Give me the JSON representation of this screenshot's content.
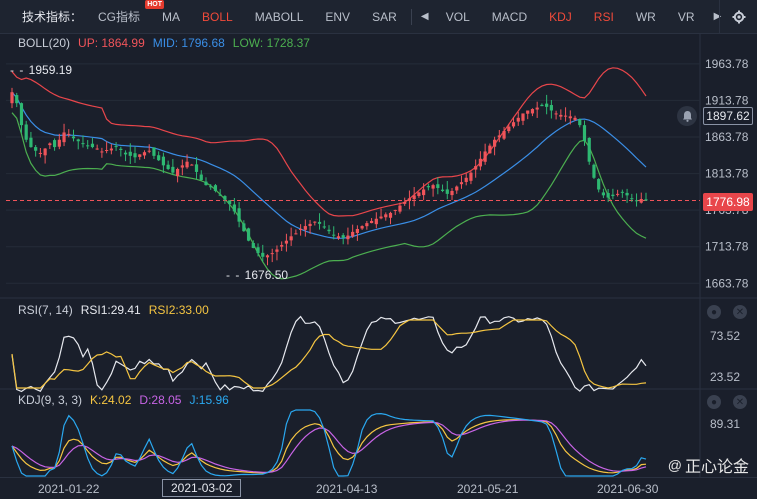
{
  "toolbar": {
    "title": "技术指标：",
    "items": [
      {
        "label": "CG指标",
        "hot": "HOT"
      },
      {
        "label": "MA"
      },
      {
        "label": "BOLL",
        "active": true
      },
      {
        "label": "MABOLL"
      },
      {
        "label": "ENV"
      },
      {
        "label": "SAR"
      }
    ],
    "items2": [
      {
        "label": "VOL"
      },
      {
        "label": "MACD"
      },
      {
        "label": "KDJ",
        "active": true
      },
      {
        "label": "RSI",
        "active": true
      },
      {
        "label": "WR"
      },
      {
        "label": "VR"
      }
    ],
    "left_arrow": "◀",
    "right_arrow": "▶"
  },
  "colors": {
    "up": "#f0545a",
    "down": "#2eb872",
    "boll_up": "#e8464b",
    "boll_mid": "#3a8ee6",
    "boll_low": "#4caf50",
    "rsi1": "#e6e8ee",
    "rsi2": "#f5c542",
    "kdj_k": "#f5c542",
    "kdj_d": "#c864e6",
    "kdj_j": "#2aa8f0"
  },
  "main_legend": {
    "name": "BOLL(20)",
    "up": "UP: 1864.99",
    "mid": "MID: 1796.68",
    "low": "LOW: 1728.37"
  },
  "rsi_legend": {
    "name": "RSI(7, 14)",
    "rsi1": "RSI1:29.41",
    "rsi2": "RSI2:33.00"
  },
  "kdj_legend": {
    "name": "KDJ(9, 3, 3)",
    "k": "K:24.02",
    "d": "D:28.05",
    "j": "J:15.96"
  },
  "price_labels": {
    "last": "1776.98",
    "marker": "1897.62",
    "high_note": "1959.19",
    "low_note": "1676.50"
  },
  "watermark": {
    "at": "@",
    "text": "正心论金"
  },
  "chart_data": [
    {
      "type": "candlestick",
      "title": "BOLL(20)",
      "yticks": [
        "1963.78",
        "1913.78",
        "1863.78",
        "1813.78",
        "1763.78",
        "1713.78",
        "1663.78"
      ],
      "ylim": [
        1645,
        1980
      ],
      "last_price": 1776.98,
      "annotations": [
        {
          "label": "1959.19",
          "value": 1959.19
        },
        {
          "label": "1676.50",
          "value": 1676.5
        }
      ],
      "candles_close": [
        1925,
        1910,
        1880,
        1860,
        1850,
        1845,
        1842,
        1848,
        1855,
        1850,
        1860,
        1870,
        1868,
        1862,
        1858,
        1855,
        1852,
        1850,
        1848,
        1844,
        1846,
        1848,
        1850,
        1846,
        1840,
        1838,
        1836,
        1840,
        1843,
        1845,
        1838,
        1832,
        1825,
        1820,
        1815,
        1820,
        1825,
        1830,
        1826,
        1816,
        1805,
        1798,
        1795,
        1790,
        1784,
        1778,
        1772,
        1762,
        1748,
        1735,
        1722,
        1712,
        1705,
        1700,
        1702,
        1705,
        1710,
        1716,
        1722,
        1728,
        1732,
        1738,
        1742,
        1745,
        1748,
        1745,
        1740,
        1735,
        1730,
        1728,
        1726,
        1729,
        1734,
        1738,
        1742,
        1746,
        1749,
        1752,
        1755,
        1758,
        1760,
        1764,
        1770,
        1775,
        1780,
        1784,
        1788,
        1792,
        1795,
        1798,
        1794,
        1790,
        1786,
        1790,
        1796,
        1802,
        1808,
        1815,
        1824,
        1834,
        1844,
        1852,
        1860,
        1866,
        1872,
        1878,
        1884,
        1890,
        1896,
        1900,
        1902,
        1904,
        1906,
        1905,
        1900,
        1896,
        1894,
        1893,
        1892,
        1890,
        1880,
        1858,
        1830,
        1808,
        1792,
        1784,
        1781,
        1783,
        1786,
        1788,
        1784,
        1780,
        1777,
        1779,
        1777
      ]
    },
    {
      "type": "line",
      "title": "RSI(7, 14)",
      "yticks": [
        "73.52",
        "23.52"
      ],
      "series": [
        {
          "name": "RSI1"
        },
        {
          "name": "RSI2"
        }
      ]
    },
    {
      "type": "line",
      "title": "KDJ(9, 3, 3)",
      "yticks": [
        "89.31"
      ],
      "series": [
        {
          "name": "K"
        },
        {
          "name": "D"
        },
        {
          "name": "J"
        }
      ]
    }
  ],
  "xaxis": {
    "labels": [
      "2021-01-22",
      "2021-03-02",
      "2021-04-13",
      "2021-05-21",
      "2021-06-30"
    ],
    "selected": "2021-03-02"
  }
}
